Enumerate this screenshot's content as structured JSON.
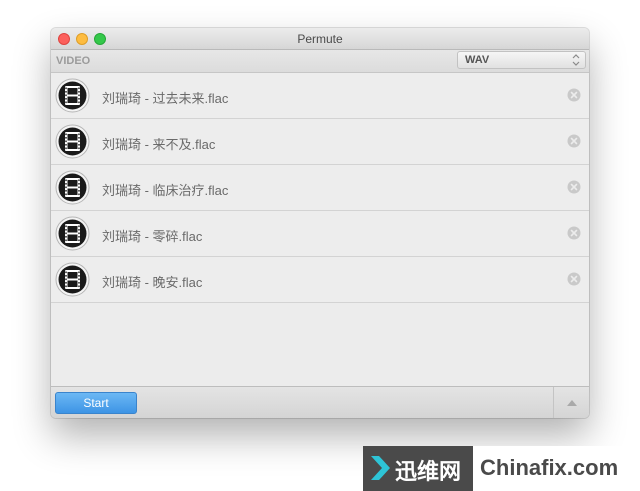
{
  "window": {
    "title": "Permute"
  },
  "toolbar": {
    "category_label": "VIDEO",
    "format_select": {
      "value": "WAV"
    }
  },
  "files": [
    {
      "name": "刘瑞琦 - 过去未来.flac",
      "icon": "film-icon"
    },
    {
      "name": "刘瑞琦 - 来不及.flac",
      "icon": "film-icon"
    },
    {
      "name": "刘瑞琦 - 临床治疗.flac",
      "icon": "film-icon"
    },
    {
      "name": "刘瑞琦 - 零碎.flac",
      "icon": "film-icon"
    },
    {
      "name": "刘瑞琦 - 晚安.flac",
      "icon": "film-icon"
    }
  ],
  "bottom": {
    "start_label": "Start"
  },
  "watermark": {
    "brand_cn": "迅维网",
    "brand_en": "Chinafix.com"
  },
  "colors": {
    "accent_button": "#4a9fea",
    "traffic_close": "#fc605c",
    "traffic_minimize": "#fdbc40",
    "traffic_zoom": "#34c84a",
    "watermark_cyan": "#2ec4d6"
  }
}
